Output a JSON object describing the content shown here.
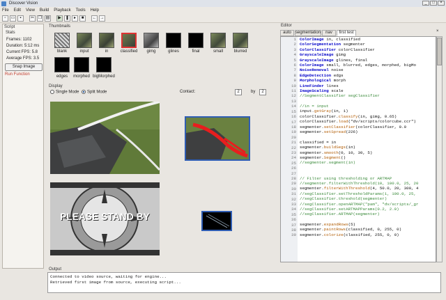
{
  "window": {
    "title": "Discover Vision"
  },
  "menu": [
    "File",
    "Edit",
    "View",
    "Build",
    "Playback",
    "Tools",
    "Help"
  ],
  "left": {
    "script_label": "Script",
    "stats_label": "Stats",
    "stats": [
      "Frames: 1102",
      "Duration: 5:12 ms",
      "Current FPS: 5.8",
      "Average FPS: 3.5"
    ],
    "snap_label": "Snap Image",
    "run_function": "Run Function"
  },
  "thumbnails": {
    "label": "Thumbnails",
    "row1": [
      "blank",
      "input",
      "in",
      "classified",
      "gimg",
      "glines",
      "final",
      "small",
      "blurred"
    ],
    "row2": [
      "edges",
      "morphed",
      "bigMorphed"
    ]
  },
  "display": {
    "label": "Display",
    "single_mode": "Single Mode",
    "split_mode": "Split Mode",
    "contact_label": "Contact:",
    "contact_a": "2",
    "by_label": "by",
    "contact_b": "2",
    "please_stand_by": "PLEASE STAND BY"
  },
  "editor": {
    "label": "Editor",
    "tabs": [
      "auto",
      "segmentation",
      "nav",
      "first test"
    ],
    "active_tab": "first test",
    "lines": [
      "ColorImage in, classified",
      "ColorSegmentation segmenter",
      "ColorClassifier colorClassifier",
      "GrayscaleImage gimg",
      "GrayscaleImage glines, final",
      "ColorImage small, blurred, edges, morphed, bigMo",
      "NoiseRemoval noise",
      "EdgeDetection edgs",
      "Morphological morph",
      "LineFinder lines",
      "ImageScaling scale",
      "//SegmentClassifier segClassifier",
      "",
      "//in = input",
      "input.getGray(in, 1)",
      "colorClassifier.classify(in, gimg, 0.65)",
      "colorClassifier.load(\"dv/scripts/colorcube.ccr\")",
      "segmenter.setClassifier(colorClassifier, 0.0",
      "segmenter.setSpread(226)",
      "",
      "classified = in",
      "segmenter.buildSegs(in)",
      "segmenter.smooth(0, 10, 30, 5)",
      "segmenter.Segment()",
      "//segmenter.segment(in)",
      "",
      "",
      "// Filter using thresholding or ARTMAP",
      "//segmenter.filterWithThreshold(10, 100.0, 25, 20",
      "segmenter.filterWithThreshold(4, 50.0, 20, 300, 4",
      "//segClassifier.setThresholdParams(1, 100.0, 25,",
      "//segClassifier.threshold(segmenter)",
      "//segClassifier.openARTMAP(\"pam\", \"dv/scripts/_gr",
      "//segClassifier.setARTMAPParams(0.2, 2.0)",
      "//segClassifier.ARTMAP(segmenter)",
      "",
      "segmenter.expandRows(5)",
      "segmenter.paintRows(classified, 0, 255, 0)",
      "segmenter.colorize(classified, 255, 0, 0)"
    ],
    "line_start": 1
  },
  "output": {
    "label": "Output",
    "lines": [
      "Connected to video source, waiting for engine...",
      "Retrieved first image from source, executing script..."
    ]
  },
  "colors": {
    "keyword": "#0000c8",
    "method": "#b05a00",
    "comment": "#3a8a3a"
  }
}
